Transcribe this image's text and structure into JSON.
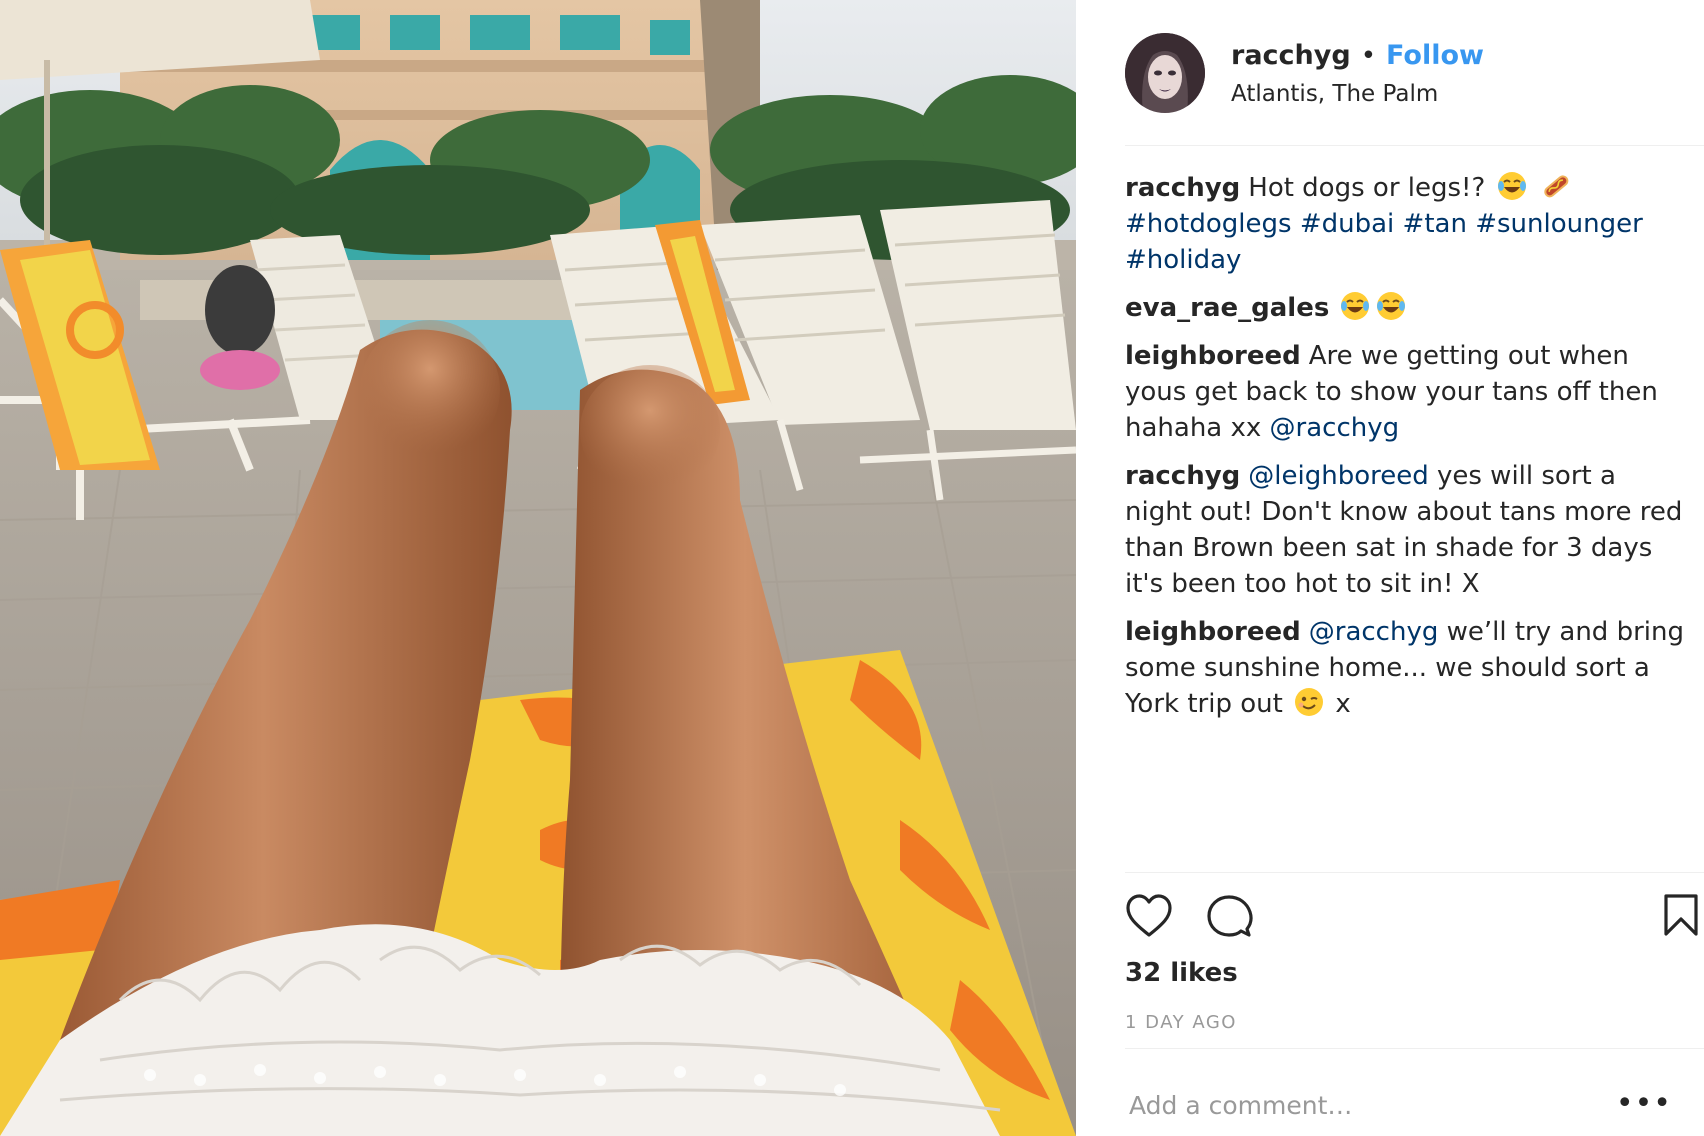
{
  "post": {
    "photo": {
      "description_icon": "photo"
    },
    "header": {
      "username": "racchyg",
      "separator": "•",
      "follow_label": "Follow",
      "location": "Atlantis, The Palm"
    },
    "caption": {
      "username": "racchyg",
      "text": "Hot dogs or legs!?",
      "emojis": [
        "laughing-tears-emoji",
        "hotdog-emoji"
      ],
      "hashtags": [
        "#hotdoglegs",
        "#dubai",
        "#tan",
        "#sunlounger",
        "#holiday"
      ]
    },
    "comments": [
      {
        "username": "eva_rae_gales",
        "text": "",
        "emojis": [
          "laughing-tears-emoji",
          "laughing-tears-emoji"
        ]
      },
      {
        "username": "leighboreed",
        "text": "Are we getting out when yous get back to show your tans off then hahaha xx",
        "mention": "@racchyg"
      },
      {
        "username": "racchyg",
        "mention": "@leighboreed",
        "text": "yes will sort a night out! Don't know about tans more red than Brown been sat in shade for 3 days it's been too hot to sit in! X"
      },
      {
        "username": "leighboreed",
        "mention": "@racchyg",
        "text": "we’ll try and bring some sunshine home... we should sort a York trip out",
        "emoji": "wink-emoji",
        "suffix": "x"
      }
    ],
    "actions": {
      "like_icon": "heart-icon",
      "comment_icon": "speech-bubble-icon",
      "save_icon": "bookmark-icon"
    },
    "likes": "32 likes",
    "timestamp": "1 DAY AGO",
    "add_comment_placeholder": "Add a comment…",
    "more_label": "•••",
    "colors": {
      "link_blue": "#3897f0",
      "hashtag_blue": "#003569",
      "text": "#262626",
      "muted": "#999999",
      "divider": "#efefef"
    }
  }
}
